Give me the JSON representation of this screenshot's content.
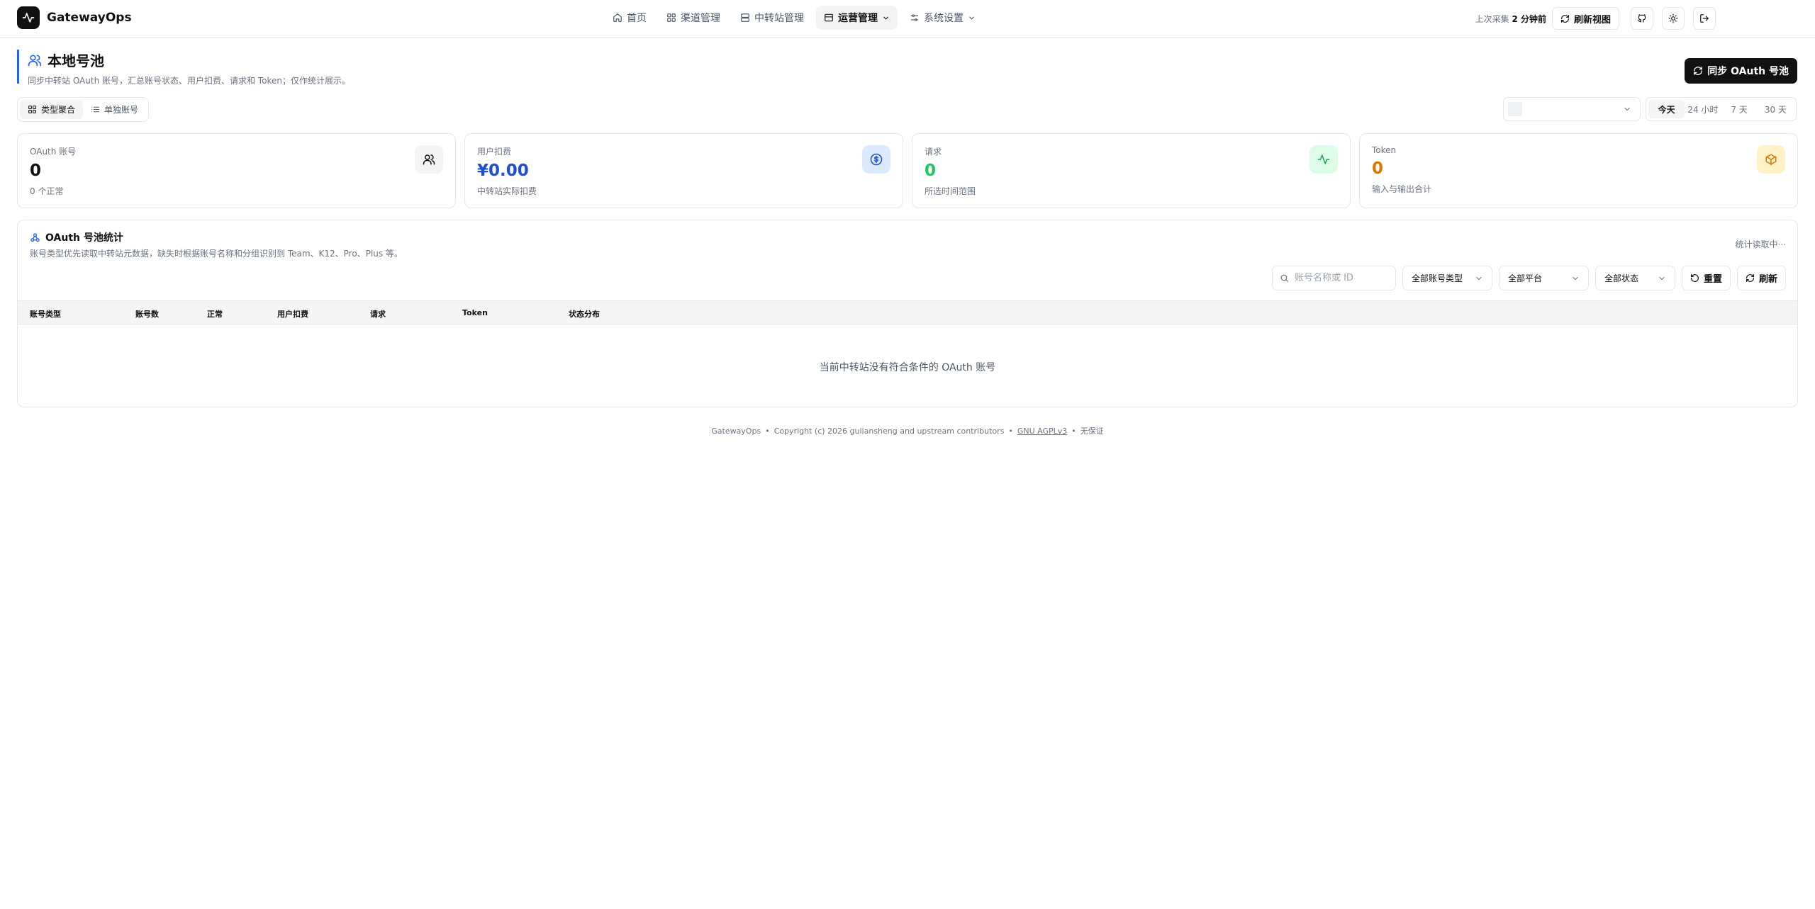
{
  "app": {
    "name": "GatewayOps"
  },
  "nav": {
    "items": [
      {
        "label": "首页",
        "icon": "home-icon"
      },
      {
        "label": "渠道管理",
        "icon": "grid-icon"
      },
      {
        "label": "中转站管理",
        "icon": "server-icon"
      },
      {
        "label": "运营管理",
        "icon": "box-icon",
        "active": true
      },
      {
        "label": "系统设置",
        "icon": "sliders-icon"
      }
    ]
  },
  "header": {
    "last_collect_prefix": "上次采集",
    "last_collect_value": "2 分钟前",
    "refresh_view": "刷新视图"
  },
  "page": {
    "title": "本地号池",
    "subtitle": "同步中转站 OAuth 账号，汇总账号状态、用户扣费、请求和 Token；仅作统计展示。",
    "sync_button": "同步 OAuth 号池"
  },
  "view_toggle": {
    "aggregate": "类型聚合",
    "single": "单独账号"
  },
  "time_range": {
    "options": [
      "今天",
      "24 小时",
      "7 天",
      "30 天"
    ],
    "selected": "今天"
  },
  "cards": {
    "oauth": {
      "label": "OAuth 账号",
      "value": "0",
      "foot": "0 个正常"
    },
    "charge": {
      "label": "用户扣费",
      "value": "¥0.00",
      "foot": "中转站实际扣费"
    },
    "requests": {
      "label": "请求",
      "value": "0",
      "foot": "所选时间范围"
    },
    "tokens": {
      "label": "Token",
      "value": "0",
      "foot": "输入与输出合计"
    }
  },
  "colors": {
    "accent": "#2563eb",
    "green": "#22c55e",
    "amber": "#d97706",
    "dark": "#111111"
  },
  "stats": {
    "title": "OAuth 号池统计",
    "subtitle": "账号类型优先读取中转站元数据，缺失时根据账号名称和分组识别到 Team、K12、Pro、Plus 等。",
    "status": "统计读取中···",
    "search_placeholder": "账号名称或 ID",
    "filter_type": "全部账号类型",
    "filter_platform": "全部平台",
    "filter_status": "全部状态",
    "reset": "重置",
    "refresh": "刷新",
    "columns": [
      "账号类型",
      "账号数",
      "正常",
      "用户扣费",
      "请求",
      "Token",
      "状态分布"
    ],
    "empty": "当前中转站没有符合条件的 OAuth 账号"
  },
  "footer": {
    "name": "GatewayOps",
    "copyright": "Copyright (c) 2026 guliansheng and upstream contributors",
    "license": "GNU AGPLv3",
    "warranty": "无保证"
  }
}
